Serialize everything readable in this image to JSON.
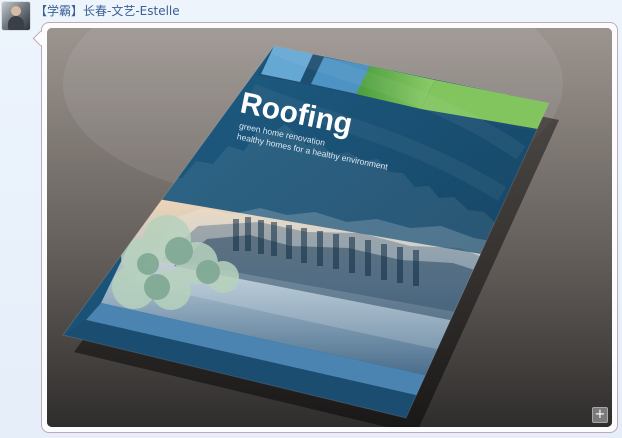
{
  "header": {
    "sender_name": "【学霸】长春-文艺-Estelle"
  },
  "message": {
    "image": {
      "headline": "Roofing",
      "subtitle_line1": "green home renovation",
      "subtitle_line2": "healthy homes for a healthy environment"
    },
    "expand_label": "+"
  },
  "colors": {
    "chat_background": "#e6eef8",
    "sender_name": "#3b5f93",
    "bubble_border": "#c3a7b4",
    "cover_blue": "#1d567d",
    "cover_green": "#71b64a"
  }
}
